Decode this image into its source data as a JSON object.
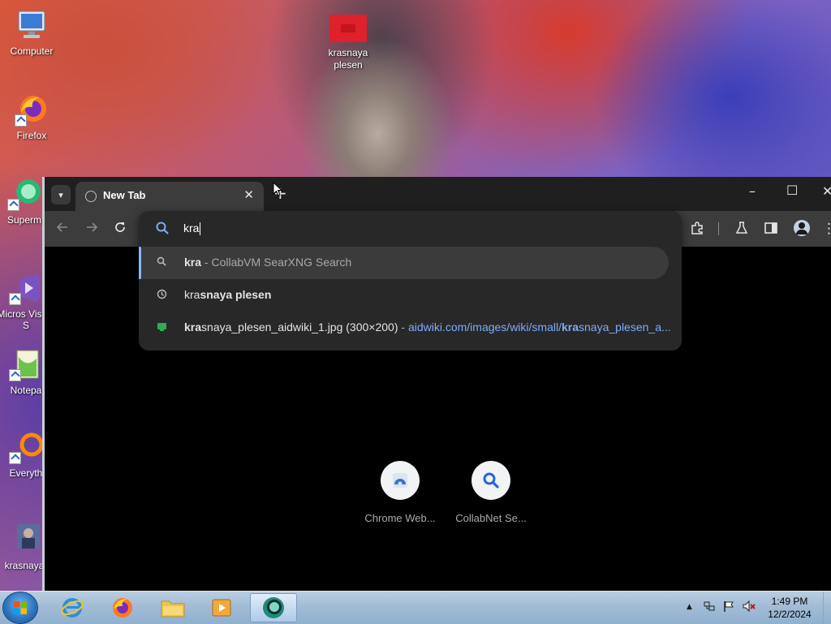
{
  "desktop": {
    "icons": [
      {
        "label": "Computer"
      },
      {
        "label": "Firefox"
      },
      {
        "label": "Superm"
      },
      {
        "label": "Micros Visual S"
      },
      {
        "label": "Notepa"
      },
      {
        "label": "Everyth"
      },
      {
        "label": "krasnaya"
      },
      {
        "label": "krasnaya plesen"
      }
    ]
  },
  "browser": {
    "tab_title": "New Tab",
    "omnibox": {
      "query": "kra",
      "suggestions": [
        {
          "bold": "kra",
          "rest": " - CollabVM SearXNG Search",
          "icon": "search-icon"
        },
        {
          "light": "kra",
          "bold": "snaya plesen",
          "icon": "history-icon"
        },
        {
          "bold": "kra",
          "light": "snaya_plesen_aidwiki_1.jpg (300×200)",
          "sep": " - ",
          "url_pre": "aidwiki.com/images/wiki/small/",
          "url_bold": "kra",
          "url_post": "snaya_plesen_a...",
          "icon": "image-icon"
        }
      ]
    },
    "shortcuts": [
      {
        "label": "Chrome Web...",
        "icon": "chrome-web-store-icon"
      },
      {
        "label": "CollabNet Se...",
        "icon": "search-icon"
      }
    ]
  },
  "taskbar": {
    "apps": [
      "internet-explorer-icon",
      "firefox-icon",
      "file-explorer-icon",
      "media-player-icon",
      "chrome-icon"
    ],
    "clock_time": "1:49 PM",
    "clock_date": "12/2/2024"
  },
  "colors": {
    "accent": "#8ab4f8",
    "link": "#7cacf8"
  }
}
